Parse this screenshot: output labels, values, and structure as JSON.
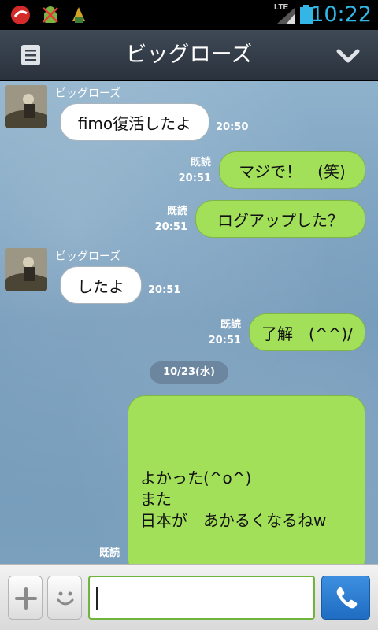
{
  "status_bar": {
    "time": "10:22",
    "network": "LTE",
    "icons": [
      "app-red-icon",
      "debug-android-icon",
      "weather-icon",
      "signal-icon",
      "battery-icon"
    ]
  },
  "header": {
    "title": "ビッグローズ",
    "left_icon": "menu-list-icon",
    "right_icon": "chevron-down-icon"
  },
  "messages": [
    {
      "type": "received",
      "sender": "ビッグローズ",
      "text": "fimo復活したよ",
      "time": "20:50"
    },
    {
      "type": "sent",
      "read": "既読",
      "text": "マジで！　(笑)",
      "time": "20:51"
    },
    {
      "type": "sent",
      "read": "既読",
      "text": "ログアップした？",
      "time": "20:51"
    },
    {
      "type": "received",
      "sender": "ビッグローズ",
      "text": "したよ",
      "time": "20:51"
    },
    {
      "type": "sent",
      "read": "既読",
      "text": "了解　(^^)/",
      "time": "20:51"
    }
  ],
  "date_separator": "10/23(水)",
  "last_message": {
    "read": "既読",
    "lines": [
      "よかった(^o^)",
      "また",
      "日本が　あかるくなるねw"
    ]
  },
  "input_bar": {
    "add_icon": "plus-icon",
    "sticker_icon": "smiley-icon",
    "input_value": "",
    "call_icon": "phone-icon"
  },
  "colors": {
    "sent_bubble": "#a3e05a",
    "received_bubble": "#ffffff",
    "header": "#2f3842",
    "time_accent": "#33b5e5",
    "call_button": "#2a7bd3"
  }
}
